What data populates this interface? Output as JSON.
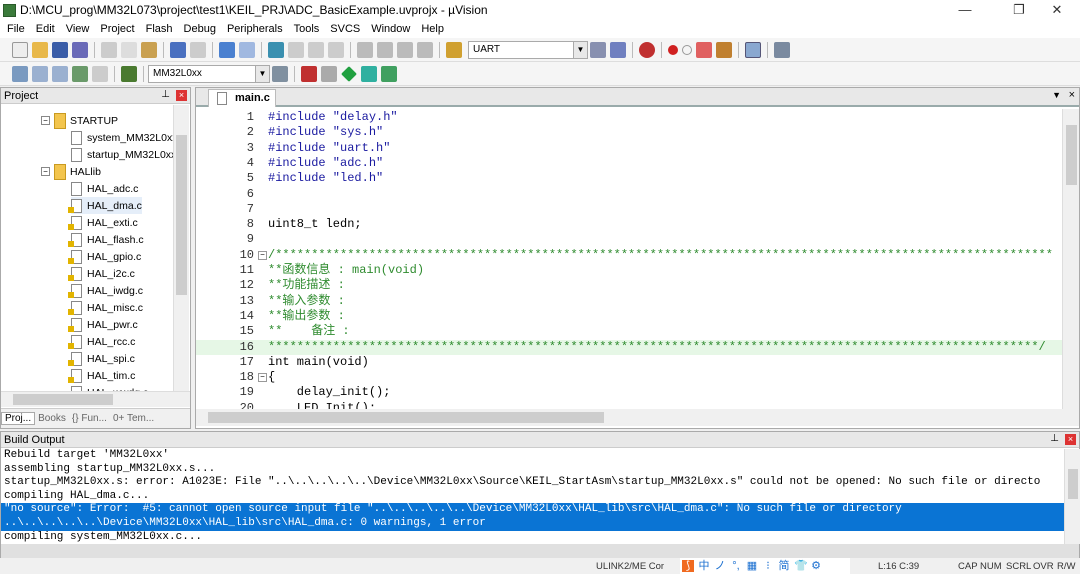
{
  "window": {
    "title": "D:\\MCU_prog\\MM32L073\\project\\test1\\KEIL_PRJ\\ADC_BasicExample.uvprojx - µVision",
    "minimize": "—",
    "maximize": "❐",
    "close": "✕"
  },
  "menu": [
    "File",
    "Edit",
    "View",
    "Project",
    "Flash",
    "Debug",
    "Peripherals",
    "Tools",
    "SVCS",
    "Window",
    "Help"
  ],
  "toolbar": {
    "find_combo": "UART",
    "target_combo": "MM32L0xx"
  },
  "project": {
    "title": "Project",
    "items": [
      {
        "label": "STARTUP",
        "type": "folder"
      },
      {
        "label": "system_MM32L0xx",
        "type": "file"
      },
      {
        "label": "startup_MM32L0xx",
        "type": "file"
      },
      {
        "label": "HALlib",
        "type": "folder"
      },
      {
        "label": "HAL_adc.c",
        "type": "file"
      },
      {
        "label": "HAL_dma.c",
        "type": "file-locked",
        "selected": true
      },
      {
        "label": "HAL_exti.c",
        "type": "file-locked"
      },
      {
        "label": "HAL_flash.c",
        "type": "file-locked"
      },
      {
        "label": "HAL_gpio.c",
        "type": "file-locked"
      },
      {
        "label": "HAL_i2c.c",
        "type": "file-locked"
      },
      {
        "label": "HAL_iwdg.c",
        "type": "file-locked"
      },
      {
        "label": "HAL_misc.c",
        "type": "file-locked"
      },
      {
        "label": "HAL_pwr.c",
        "type": "file-locked"
      },
      {
        "label": "HAL_rcc.c",
        "type": "file-locked"
      },
      {
        "label": "HAL_spi.c",
        "type": "file-locked"
      },
      {
        "label": "HAL_tim.c",
        "type": "file-locked"
      },
      {
        "label": "HAL_wwdg.c",
        "type": "file-locked"
      }
    ],
    "tabs": [
      "Proj...",
      "Books",
      "{} Fun...",
      "0+ Tem..."
    ]
  },
  "editor": {
    "tab": "main.c",
    "current_line": 16,
    "lines": [
      {
        "n": "1",
        "t": "#include \"delay.h\"",
        "c": "pp"
      },
      {
        "n": "2",
        "t": "#include \"sys.h\"",
        "c": "pp"
      },
      {
        "n": "3",
        "t": "#include \"uart.h\"",
        "c": "pp"
      },
      {
        "n": "4",
        "t": "#include \"adc.h\"",
        "c": "pp"
      },
      {
        "n": "5",
        "t": "#include \"led.h\"",
        "c": "pp"
      },
      {
        "n": "6",
        "t": "",
        "c": ""
      },
      {
        "n": "7",
        "t": "",
        "c": ""
      },
      {
        "n": "8",
        "t": "uint8_t ledn;",
        "c": ""
      },
      {
        "n": "9",
        "t": "",
        "c": ""
      },
      {
        "n": "10",
        "t": "/************************************************************************************************************",
        "c": "cm"
      },
      {
        "n": "11",
        "t": "**函数信息 : main(void)",
        "c": "cm"
      },
      {
        "n": "12",
        "t": "**功能描述 :",
        "c": "cm"
      },
      {
        "n": "13",
        "t": "**输入参数 :",
        "c": "cm"
      },
      {
        "n": "14",
        "t": "**输出参数 :",
        "c": "cm"
      },
      {
        "n": "15",
        "t": "**    备注 :",
        "c": "cm"
      },
      {
        "n": "16",
        "t": "***********************************************************************************************************/",
        "c": "cm"
      },
      {
        "n": "17",
        "t": "int main(void)",
        "c": ""
      },
      {
        "n": "18",
        "t": "{",
        "c": ""
      },
      {
        "n": "19",
        "t": "    delay_init();",
        "c": ""
      },
      {
        "n": "20",
        "t": "    LED_Init();",
        "c": ""
      }
    ]
  },
  "build": {
    "title": "Build Output",
    "lines": [
      {
        "t": "Rebuild target 'MM32L0xx'"
      },
      {
        "t": "assembling startup_MM32L0xx.s..."
      },
      {
        "t": "startup_MM32L0xx.s: error: A1023E: File \"..\\..\\..\\..\\..\\Device\\MM32L0xx\\Source\\KEIL_StartAsm\\startup_MM32L0xx.s\" could not be opened: No such file or directo"
      },
      {
        "t": "compiling HAL_dma.c..."
      },
      {
        "t": "\"no source\": Error:  #5: cannot open source input file \"..\\..\\..\\..\\..\\Device\\MM32L0xx\\HAL_lib\\src\\HAL_dma.c\": No such file or directory",
        "err": true
      },
      {
        "t": "..\\..\\..\\..\\..\\Device\\MM32L0xx\\HAL_lib\\src\\HAL_dma.c: 0 warnings, 1 error",
        "err": true
      },
      {
        "t": "compiling system_MM32L0xx.c..."
      }
    ]
  },
  "status": {
    "debugger": "ULINK2/ME Cor",
    "position": "L:16 C:39",
    "cap": "CAP",
    "num": "NUM",
    "scrl": "SCRL",
    "ovr": "OVR",
    "rw": "R/W",
    "ime": [
      "中",
      "ノ",
      "°,",
      "▦",
      "⁝",
      "简",
      "👕",
      "⚙"
    ]
  },
  "colors": {
    "selection": "#0a74d4",
    "comment": "#2e8b2e",
    "current_line": "#e6f7e6"
  }
}
